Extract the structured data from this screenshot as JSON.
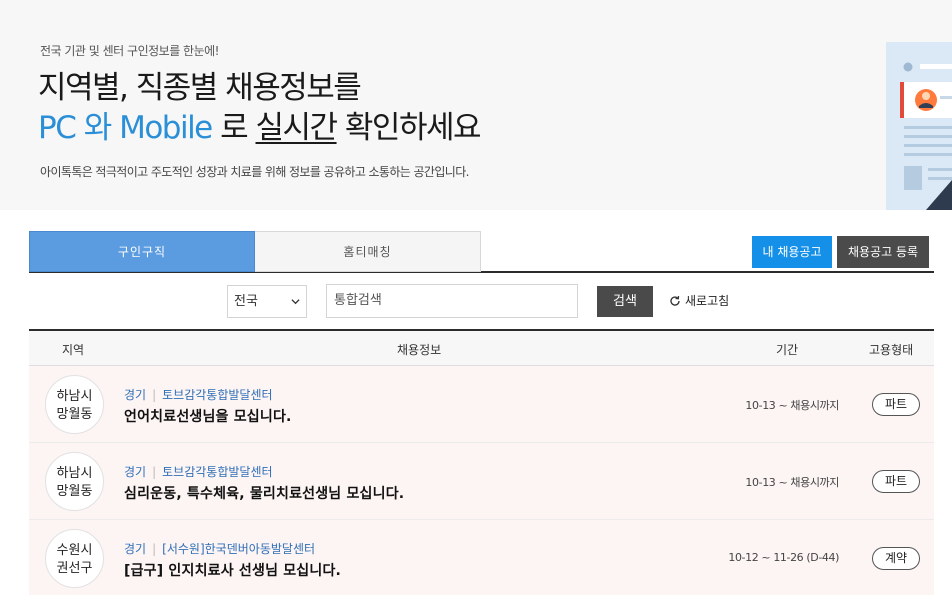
{
  "hero": {
    "subtitle": "전국 기관 및 센터 구인정보를 한눈에!",
    "line1": "지역별, 직종별 채용정보를",
    "line2_accent": "PC 와 Mobile",
    "line2_mid": " 로 ",
    "line2_underline": "실시간",
    "line2_end": " 확인하세요",
    "description": "아이톡톡은 적극적이고 주도적인 성장과 치료를 위해 정보를 공유하고 소통하는 공간입니다.",
    "accent_color": "#2b8fd8"
  },
  "tabs": {
    "active": "구인구직",
    "inactive": "홈티매칭"
  },
  "actions": {
    "my_jobs": "내 채용공고",
    "register": "채용공고 등록"
  },
  "search": {
    "region_selected": "전국",
    "placeholder": "통합검색",
    "button": "검색",
    "refresh": "새로고침"
  },
  "table": {
    "headers": {
      "region": "지역",
      "info": "채용정보",
      "period": "기간",
      "type": "고용형태"
    },
    "rows": [
      {
        "region_line1": "하남시",
        "region_line2": "망월동",
        "province": "경기",
        "center": "토브감각통합발달센터",
        "title": "언어치료선생님을 모십니다.",
        "period": "10-13 ~ 채용시까지",
        "type": "파트"
      },
      {
        "region_line1": "하남시",
        "region_line2": "망월동",
        "province": "경기",
        "center": "토브감각통합발달센터",
        "title": "심리운동, 특수체육, 물리치료선생님 모십니다.",
        "period": "10-13 ~ 채용시까지",
        "type": "파트"
      },
      {
        "region_line1": "수원시",
        "region_line2": "권선구",
        "province": "경기",
        "center": "[서수원]한국덴버아동발달센터",
        "title": "[급구] 인지치료사 선생님 모십니다.",
        "period": "10-12 ~ 11-26 (D-44)",
        "type": "계약"
      }
    ]
  }
}
